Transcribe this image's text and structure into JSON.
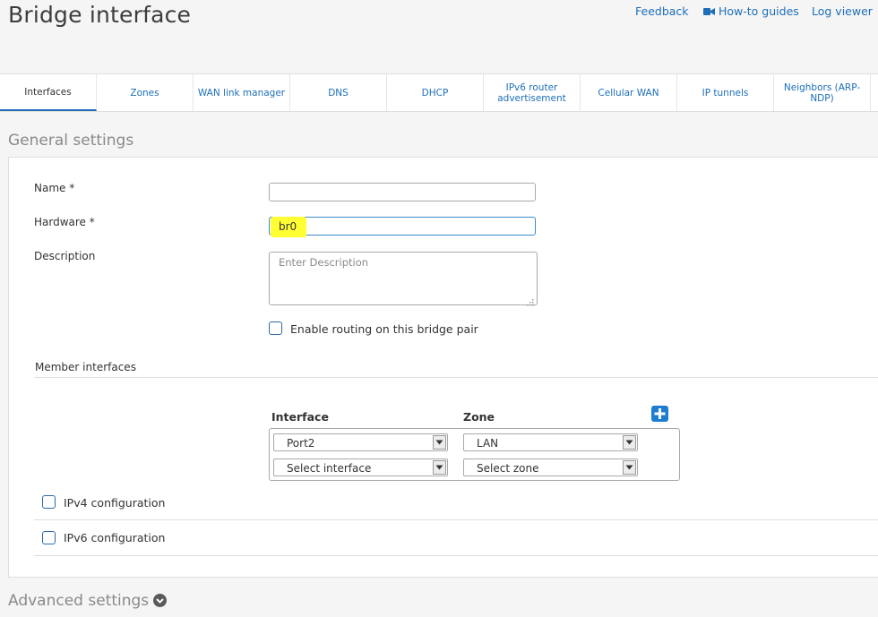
{
  "header": {
    "title": "Bridge interface",
    "links": {
      "feedback": "Feedback",
      "how_to": "How-to guides",
      "log_viewer": "Log viewer"
    },
    "how_to_icon": "video-camera-icon"
  },
  "tabs": [
    {
      "label": "Interfaces",
      "active": true
    },
    {
      "label": "Zones"
    },
    {
      "label": "WAN link manager"
    },
    {
      "label": "DNS"
    },
    {
      "label": "DHCP"
    },
    {
      "label": "IPv6 router advertisement"
    },
    {
      "label": "Cellular WAN"
    },
    {
      "label": "IP tunnels"
    },
    {
      "label": "Neighbors (ARP-NDP)"
    }
  ],
  "general": {
    "title": "General settings",
    "name": {
      "label": "Name *",
      "value": ""
    },
    "hardware": {
      "label": "Hardware *",
      "value": "br0"
    },
    "description": {
      "label": "Description",
      "placeholder": "Enter Description"
    },
    "routing": {
      "label": "Enable routing on this bridge pair",
      "checked": false
    },
    "member": {
      "title": "Member interfaces",
      "col_interface": "Interface",
      "col_zone": "Zone",
      "rows": [
        {
          "interface": "Port2",
          "zone": "LAN"
        },
        {
          "interface": "Select interface",
          "zone": "Select zone"
        }
      ]
    },
    "ipv4": {
      "label": "IPv4 configuration",
      "checked": false
    },
    "ipv6": {
      "label": "IPv6 configuration",
      "checked": false
    }
  },
  "advanced": {
    "title": "Advanced settings",
    "icon": "chevron-down-circle-icon"
  },
  "colors": {
    "accent": "#1d6fb8",
    "highlight": "#ffff33",
    "button": "#1d7dd2"
  }
}
